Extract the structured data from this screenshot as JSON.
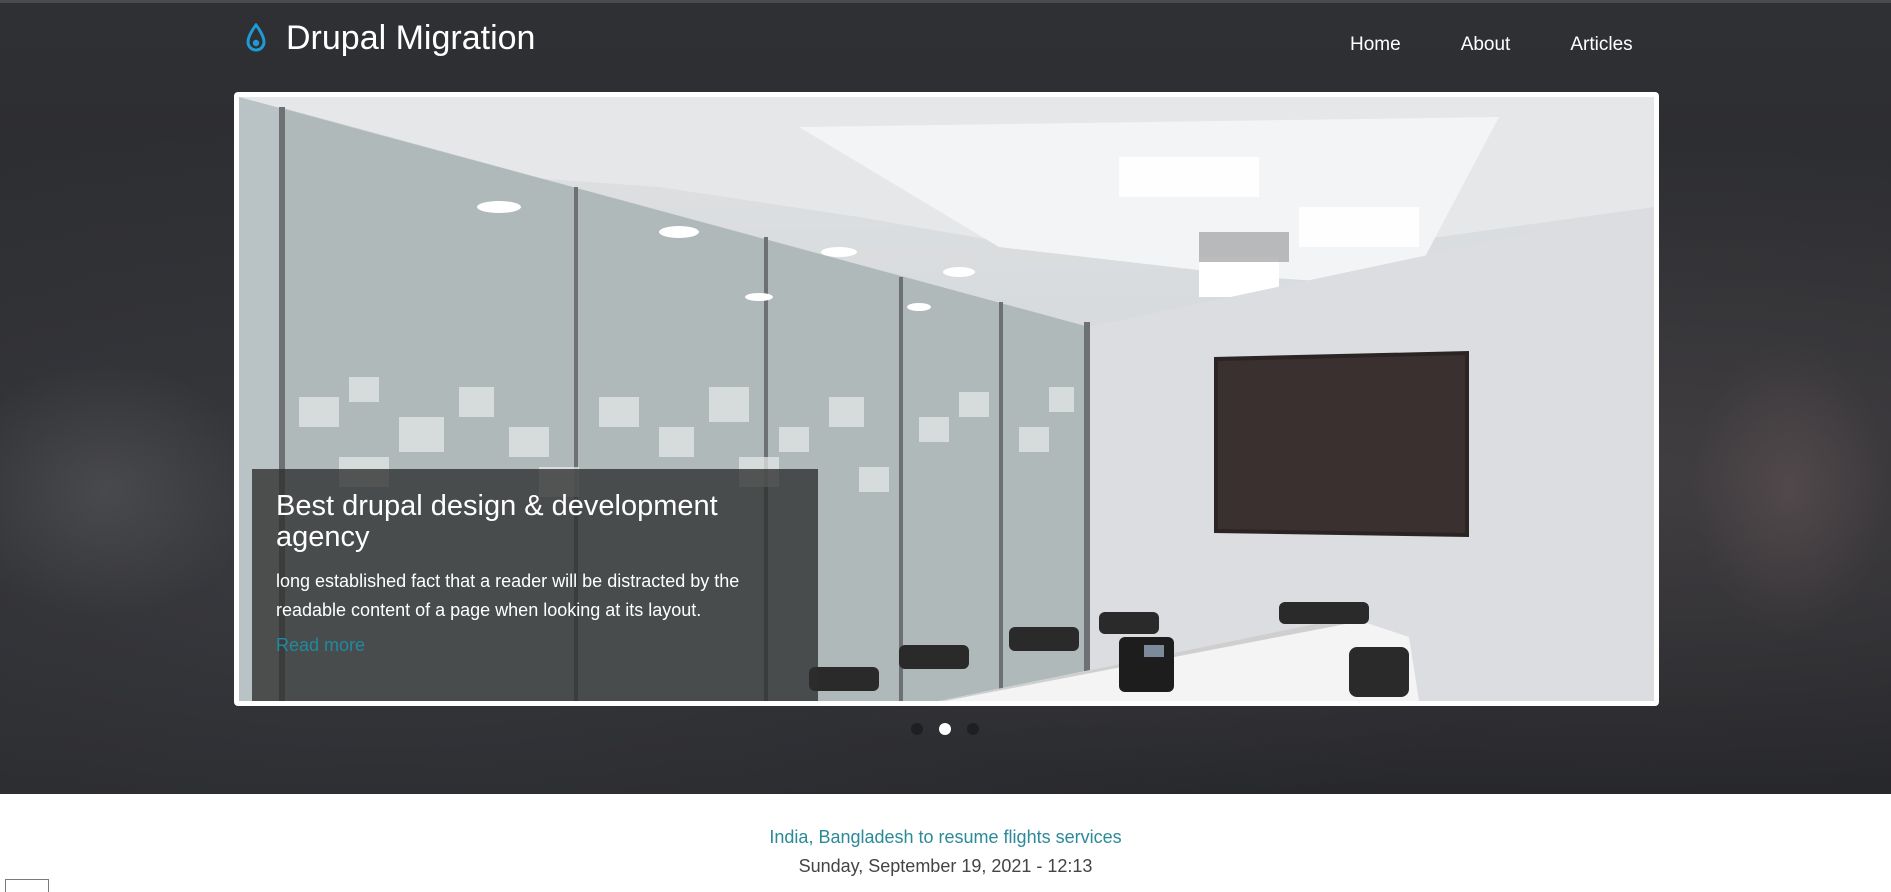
{
  "site": {
    "name": "Drupal Migration",
    "logo_icon": "drupal-drop-icon"
  },
  "nav": {
    "items": [
      {
        "label": "Home"
      },
      {
        "label": "About"
      },
      {
        "label": "Articles"
      }
    ]
  },
  "slider": {
    "caption_title": "Best drupal design & development agency",
    "caption_body": "long established fact that a reader will be distracted by the readable content of a page when looking at its layout.",
    "caption_link": "Read more",
    "slide_count": 3,
    "active_slide_index": 1
  },
  "news": {
    "headline": "India, Bangladesh to resume flights services",
    "date": "Sunday, September 19, 2021 - 12:13"
  },
  "colors": {
    "link_accent": "#2a8a98",
    "logo_blue": "#1e9bd7"
  }
}
